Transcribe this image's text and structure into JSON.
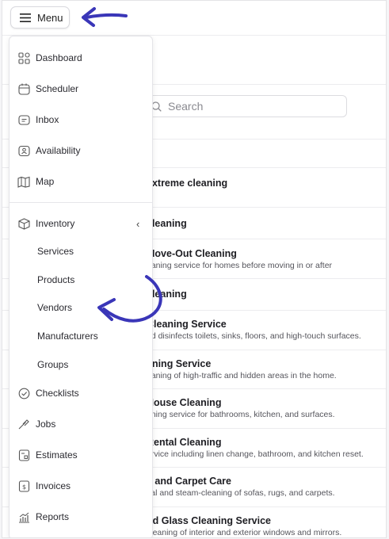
{
  "topbar": {
    "menu_label": "Menu"
  },
  "search": {
    "placeholder": "Search"
  },
  "sidebar": {
    "items": [
      {
        "label": "Dashboard",
        "icon": "dashboard-icon"
      },
      {
        "label": "Scheduler",
        "icon": "calendar-icon"
      },
      {
        "label": "Inbox",
        "icon": "inbox-icon"
      },
      {
        "label": "Availability",
        "icon": "availability-icon"
      },
      {
        "label": "Map",
        "icon": "map-icon"
      }
    ],
    "inventory": {
      "label": "Inventory",
      "chevron": "‹",
      "sub_items": [
        "Services",
        "Products",
        "Vendors",
        "Manufacturers",
        "Groups"
      ]
    },
    "bottom_items": [
      {
        "label": "Checklists",
        "icon": "checklist-icon"
      },
      {
        "label": "Jobs",
        "icon": "jobs-icon"
      },
      {
        "label": "Estimates",
        "icon": "estimates-icon"
      },
      {
        "label": "Invoices",
        "icon": "invoice-icon"
      },
      {
        "label": "Reports",
        "icon": "reports-icon"
      }
    ]
  },
  "list": {
    "rows": [
      {
        "title": "extreme cleaning",
        "desc": ""
      },
      {
        "title": "cleaning",
        "desc": ""
      },
      {
        "title": "Move-Out Cleaning",
        "desc": "eaning service for homes before moving in or after"
      },
      {
        "title": "cleaning",
        "desc": ""
      },
      {
        "title": "Cleaning Service",
        "desc": "nd disinfects toilets, sinks, floors, and high-touch surfaces."
      },
      {
        "title": "aning Service",
        "desc": "eaning of high-traffic and hidden areas in the home."
      },
      {
        "title": "House Cleaning",
        "desc": "aning service for bathrooms, kitchen, and surfaces."
      },
      {
        "title": "Rental Cleaning",
        "desc": "ervice including linen change, bathroom, and kitchen reset."
      },
      {
        "title": "y and Carpet Care",
        "desc": "val and steam-cleaning of sofas, rugs, and carpets."
      },
      {
        "title": "nd Glass Cleaning Service",
        "desc": "cleaning of interior and exterior windows and mirrors."
      }
    ]
  },
  "colors": {
    "annotation": "#3a36b8",
    "border": "#e4e4e8",
    "text": "#2a2a30"
  }
}
